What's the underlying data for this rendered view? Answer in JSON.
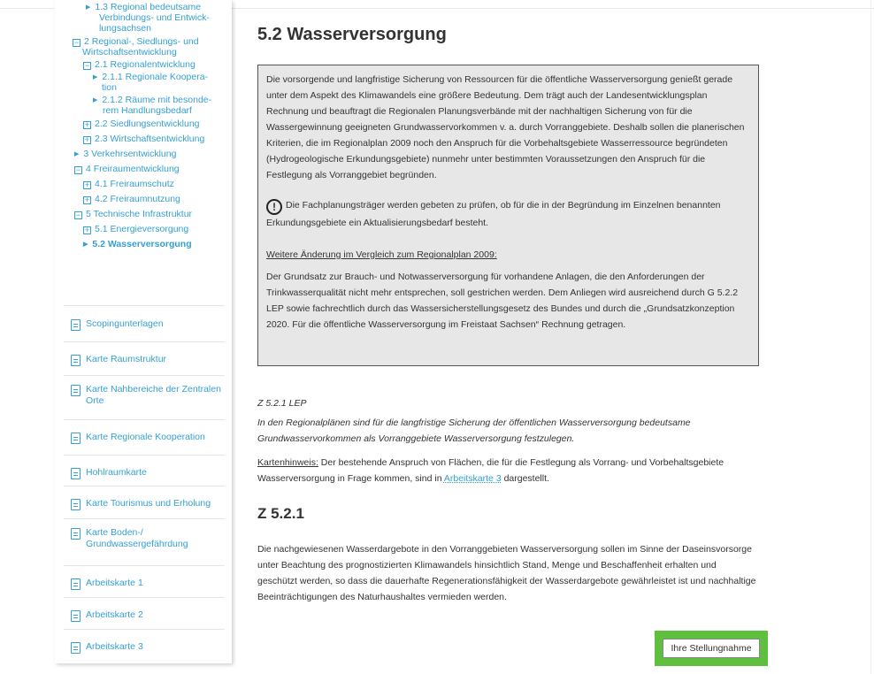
{
  "sidebar": {
    "tree": [
      {
        "label": "1.3 Regional bedeutsame",
        "marker": "triangle"
      },
      {
        "label": "Verbindungs- und Entwick-",
        "marker": "none"
      },
      {
        "label": "lungsachsen",
        "marker": "none"
      },
      {
        "label": "2 Regional-, Siedlungs- und",
        "marker": "minus"
      },
      {
        "label": "Wirtschaftsentwicklung",
        "marker": "none"
      },
      {
        "label": "2.1 Regionalentwicklung",
        "marker": "minus"
      },
      {
        "label": "2.1.1 Regionale Koopera-",
        "marker": "triangle"
      },
      {
        "label": "tion",
        "marker": "none"
      },
      {
        "label": "2.1.2 Räume mit besonde-",
        "marker": "triangle"
      },
      {
        "label": "rem Handlungsbedarf",
        "marker": "none"
      },
      {
        "label": "2.2 Siedlungsentwicklung",
        "marker": "plus"
      },
      {
        "label": "2.3 Wirtschaftsentwicklung",
        "marker": "plus"
      },
      {
        "label": "3 Verkehrsentwicklung",
        "marker": "triangle"
      },
      {
        "label": "4 Freiraumentwicklung",
        "marker": "minus"
      },
      {
        "label": "4.1 Freiraumschutz",
        "marker": "plus"
      },
      {
        "label": "4.2 Freiraumnutzung",
        "marker": "plus"
      },
      {
        "label": "5 Technische Infrastruktur",
        "marker": "minus"
      },
      {
        "label": "5.1 Energieversorgung",
        "marker": "plus"
      },
      {
        "label": "5.2 Wasserversorgung",
        "marker": "triangle"
      }
    ],
    "docs": [
      {
        "lines": [
          "Scopingunterlagen"
        ]
      },
      {
        "lines": [
          "Karte Raumstruktur"
        ]
      },
      {
        "lines": [
          "Karte Nahbereiche der Zentralen",
          "Orte"
        ]
      },
      {
        "lines": [
          "Karte Regionale Kooperation"
        ]
      },
      {
        "lines": [
          "Hohlraumkarte"
        ]
      },
      {
        "lines": [
          "Karte Tourismus und Erholung"
        ]
      },
      {
        "lines": [
          "Karte Boden-/",
          "Grundwassergefährdung"
        ]
      },
      {
        "lines": [
          "Arbeitskarte 1"
        ]
      },
      {
        "lines": [
          "Arbeitskarte 2"
        ]
      },
      {
        "lines": [
          "Arbeitskarte 3"
        ]
      }
    ],
    "icon": "document-icon"
  },
  "main": {
    "title": "5.2 Wasserversorgung",
    "box": {
      "p1": "Die vorsorgende und langfristige Sicherung von Ressourcen für die öffentliche Wasserversorgung genießt gerade unter dem Aspekt des Klimawandels eine größere Bedeutung. Dem trägt auch der Landesentwicklungsplan Rechnung und beauftragt die Regionalen Planungsverbände mit der nachhaltigen Sicherung von für die Wassergewinnung geeigneten Grundwasservorkommen v. a. durch Vorranggebiete. Deshalb sollen die planerischen Kriterien, die im Regionalplan 2009 noch den Anspruch für die Vorbehaltsgebiete Wasserressource begründeten (Hydrogeologische Erkundungsgebiete) nunmehr unter bestimmten Voraussetzungen den Anspruch für die Festlegung als Vorranggebiet begründen.",
      "p2": "Die Fachplanungsträger werden gebeten zu prüfen, ob für die in der Begründung im Einzelnen benannten Erkundungsgebiete ein Aktualisierungsbedarf besteht.",
      "p3": "Weitere Änderung im Vergleich zum Regionalplan 2009:",
      "p4": "Der Grundsatz zur Brauch- und Notwasserversorgung für vorhandene Anlagen, die den Anforderungen der Trinkwasserqualität nicht mehr entsprechen, soll gestrichen werden. Dem Anliegen wird ausreichend durch G 5.2.2 LEP sowie fachrechtlich durch das Wassersicherstellungsgesetz des Bundes und durch die „Grundsatzkonzeption 2020. Für die öffentliche Wasserversorgung im Freistaat Sachsen“ Rechnung getragen."
    },
    "lep_heading": "Z 5.2.1 LEP",
    "lep_text": "In den Regionalplänen sind für die langfristige Sicherung der öffentlichen Wasserversorgung bedeutsame Grundwasservorkommen als Vorranggebiete Wasserversorgung festzulegen.",
    "karten_label": "Kartenhinweis:",
    "karten_text_before": " Der bestehende Anspruch von Flächen, die für die Festlegung als Vorrang- und Vorbehaltsgebiete Wasserversorgung in Frage kommen, sind in ",
    "karten_link": "Arbeitskarte 3",
    "karten_text_after": " dargestellt.",
    "z_heading": "Z 5.2.1",
    "z_text": "Die nachgewiesenen Wasserdargebote in den Vorranggebieten Wasserversorgung sollen im Sinne der Daseinsvorsorge unter Beachtung des prognostizierten Klimawandels hinsichtlich Stand, Menge und Beschaffenheit erhalten und geschützt werden, so dass die dauerhafte Regenerationsfähigkeit der Wasserdargebote gewährleistet ist und nachhaltige Beeinträchtigungen des Naturhaushaltes vermieden werden.",
    "button_label": "Ihre Stellungnahme",
    "alert_icon_glyph": "!"
  },
  "colors": {
    "link": "#35a0d2",
    "highlight": "#5fbf3e",
    "box_bg": "#e7e7e7"
  }
}
